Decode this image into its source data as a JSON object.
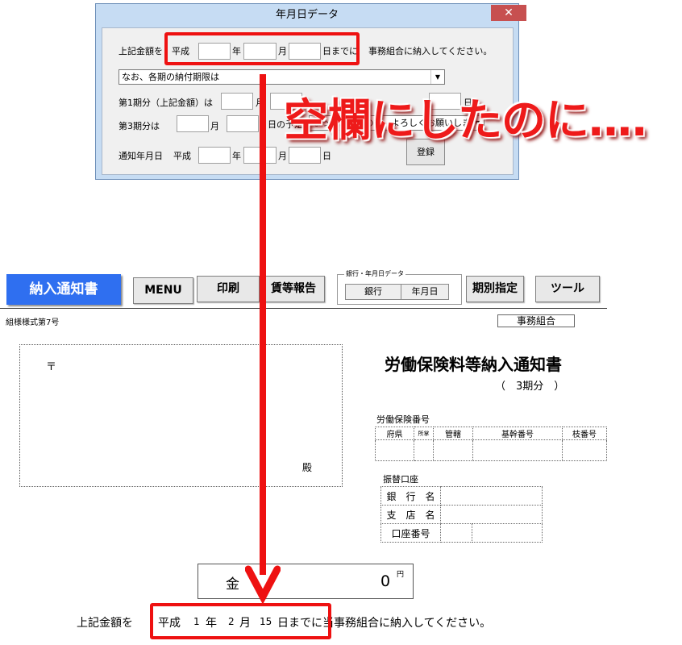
{
  "dialog": {
    "title": "年月日データ",
    "close_glyph": "✕",
    "row1": {
      "label": "上記金額を",
      "era": "平成",
      "year": "年",
      "month": "月",
      "day_suffix": "日までに",
      "suffix": "事務組合に納入してください。"
    },
    "combo_text": "なお、各期の納付期限は",
    "row3": {
      "label": "第1期分（上記金額）は",
      "month": "月",
      "day": "日"
    },
    "row4": {
      "label": "第3期分は",
      "month": "月",
      "mid": "日の予定",
      "mid2": "なっていますので、よろしくお願いします。"
    },
    "row5": {
      "label": "通知年月日",
      "era": "平成",
      "year": "年",
      "month": "月",
      "day": "日"
    },
    "register_button": "登録"
  },
  "overlay": {
    "text": "空欄にしたのに‥‥"
  },
  "sheet": {
    "title_button": "納入通知書",
    "toolbar": {
      "menu": "MENU",
      "print": "印刷",
      "report": "賃等報告",
      "group_label": "銀行・年月日データ",
      "bank": "銀行",
      "date": "年月日",
      "period": "期別指定",
      "tools": "ツール"
    },
    "form_number": "組様様式第7号",
    "jimu_label": "事務組合",
    "address": {
      "postal": "〒",
      "honorific": "殿"
    },
    "doc_title": "労働保険料等納入通知書",
    "period": "（　3期分　）",
    "insurance_no_label": "労働保険番号",
    "insurance_headers": [
      "府県",
      "所掌",
      "管轄",
      "基幹番号",
      "枝番号"
    ],
    "transfer_label": "振替口座",
    "transfer_rows": [
      "銀　行　名",
      "支　店　名",
      "口座番号"
    ],
    "amount": {
      "label": "金",
      "value": "0",
      "unit": "円"
    },
    "bottom_line": {
      "prefix": "上記金額を",
      "era": "平成",
      "year_value": "1",
      "year": "年",
      "month_value": "2",
      "month": "月",
      "day_value": "15",
      "day_suffix": "日までに",
      "suffix": "当事務組合に納入してください。"
    }
  }
}
